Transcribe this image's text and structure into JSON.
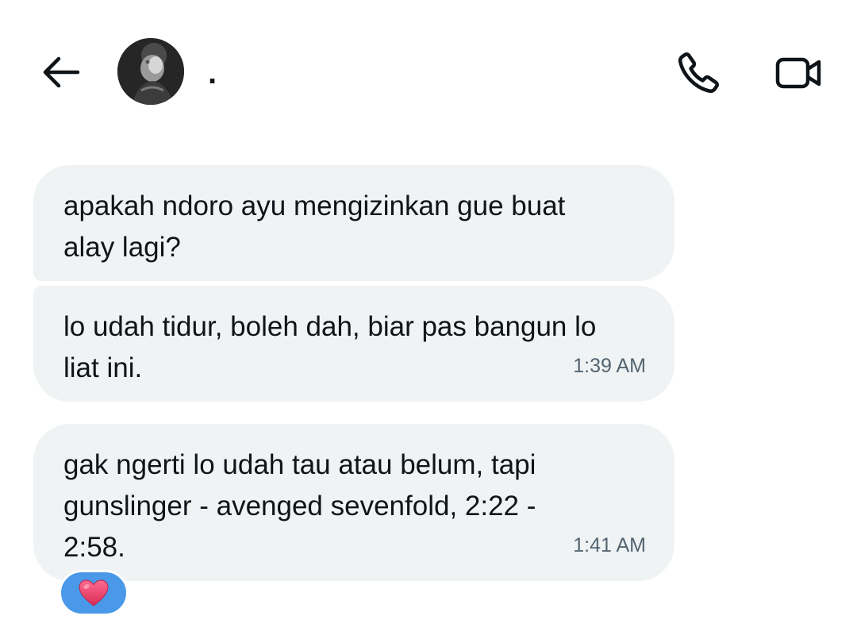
{
  "header": {
    "contact_name": ".",
    "back_icon": "arrow-left-icon",
    "call_icon": "phone-icon",
    "video_icon": "video-camera-icon"
  },
  "messages": [
    {
      "text": "apakah ndoro ayu mengizinkan gue buat\nalay lagi?",
      "time": ""
    },
    {
      "text": "lo udah tidur, boleh dah, biar pas bangun lo\nliat ini.",
      "time": "1:39 AM"
    },
    {
      "text": "gak ngerti lo udah tau atau belum, tapi\ngunslinger - avenged sevenfold, 2:22 -\n2:58.",
      "time": "1:41 AM"
    }
  ],
  "reaction": {
    "emoji": "heart-icon",
    "color": "#4a99e9"
  },
  "colors": {
    "bubble_bg": "#eff3f4",
    "text": "#0f1419",
    "timestamp": "#536471",
    "heart": "#e8416a"
  }
}
